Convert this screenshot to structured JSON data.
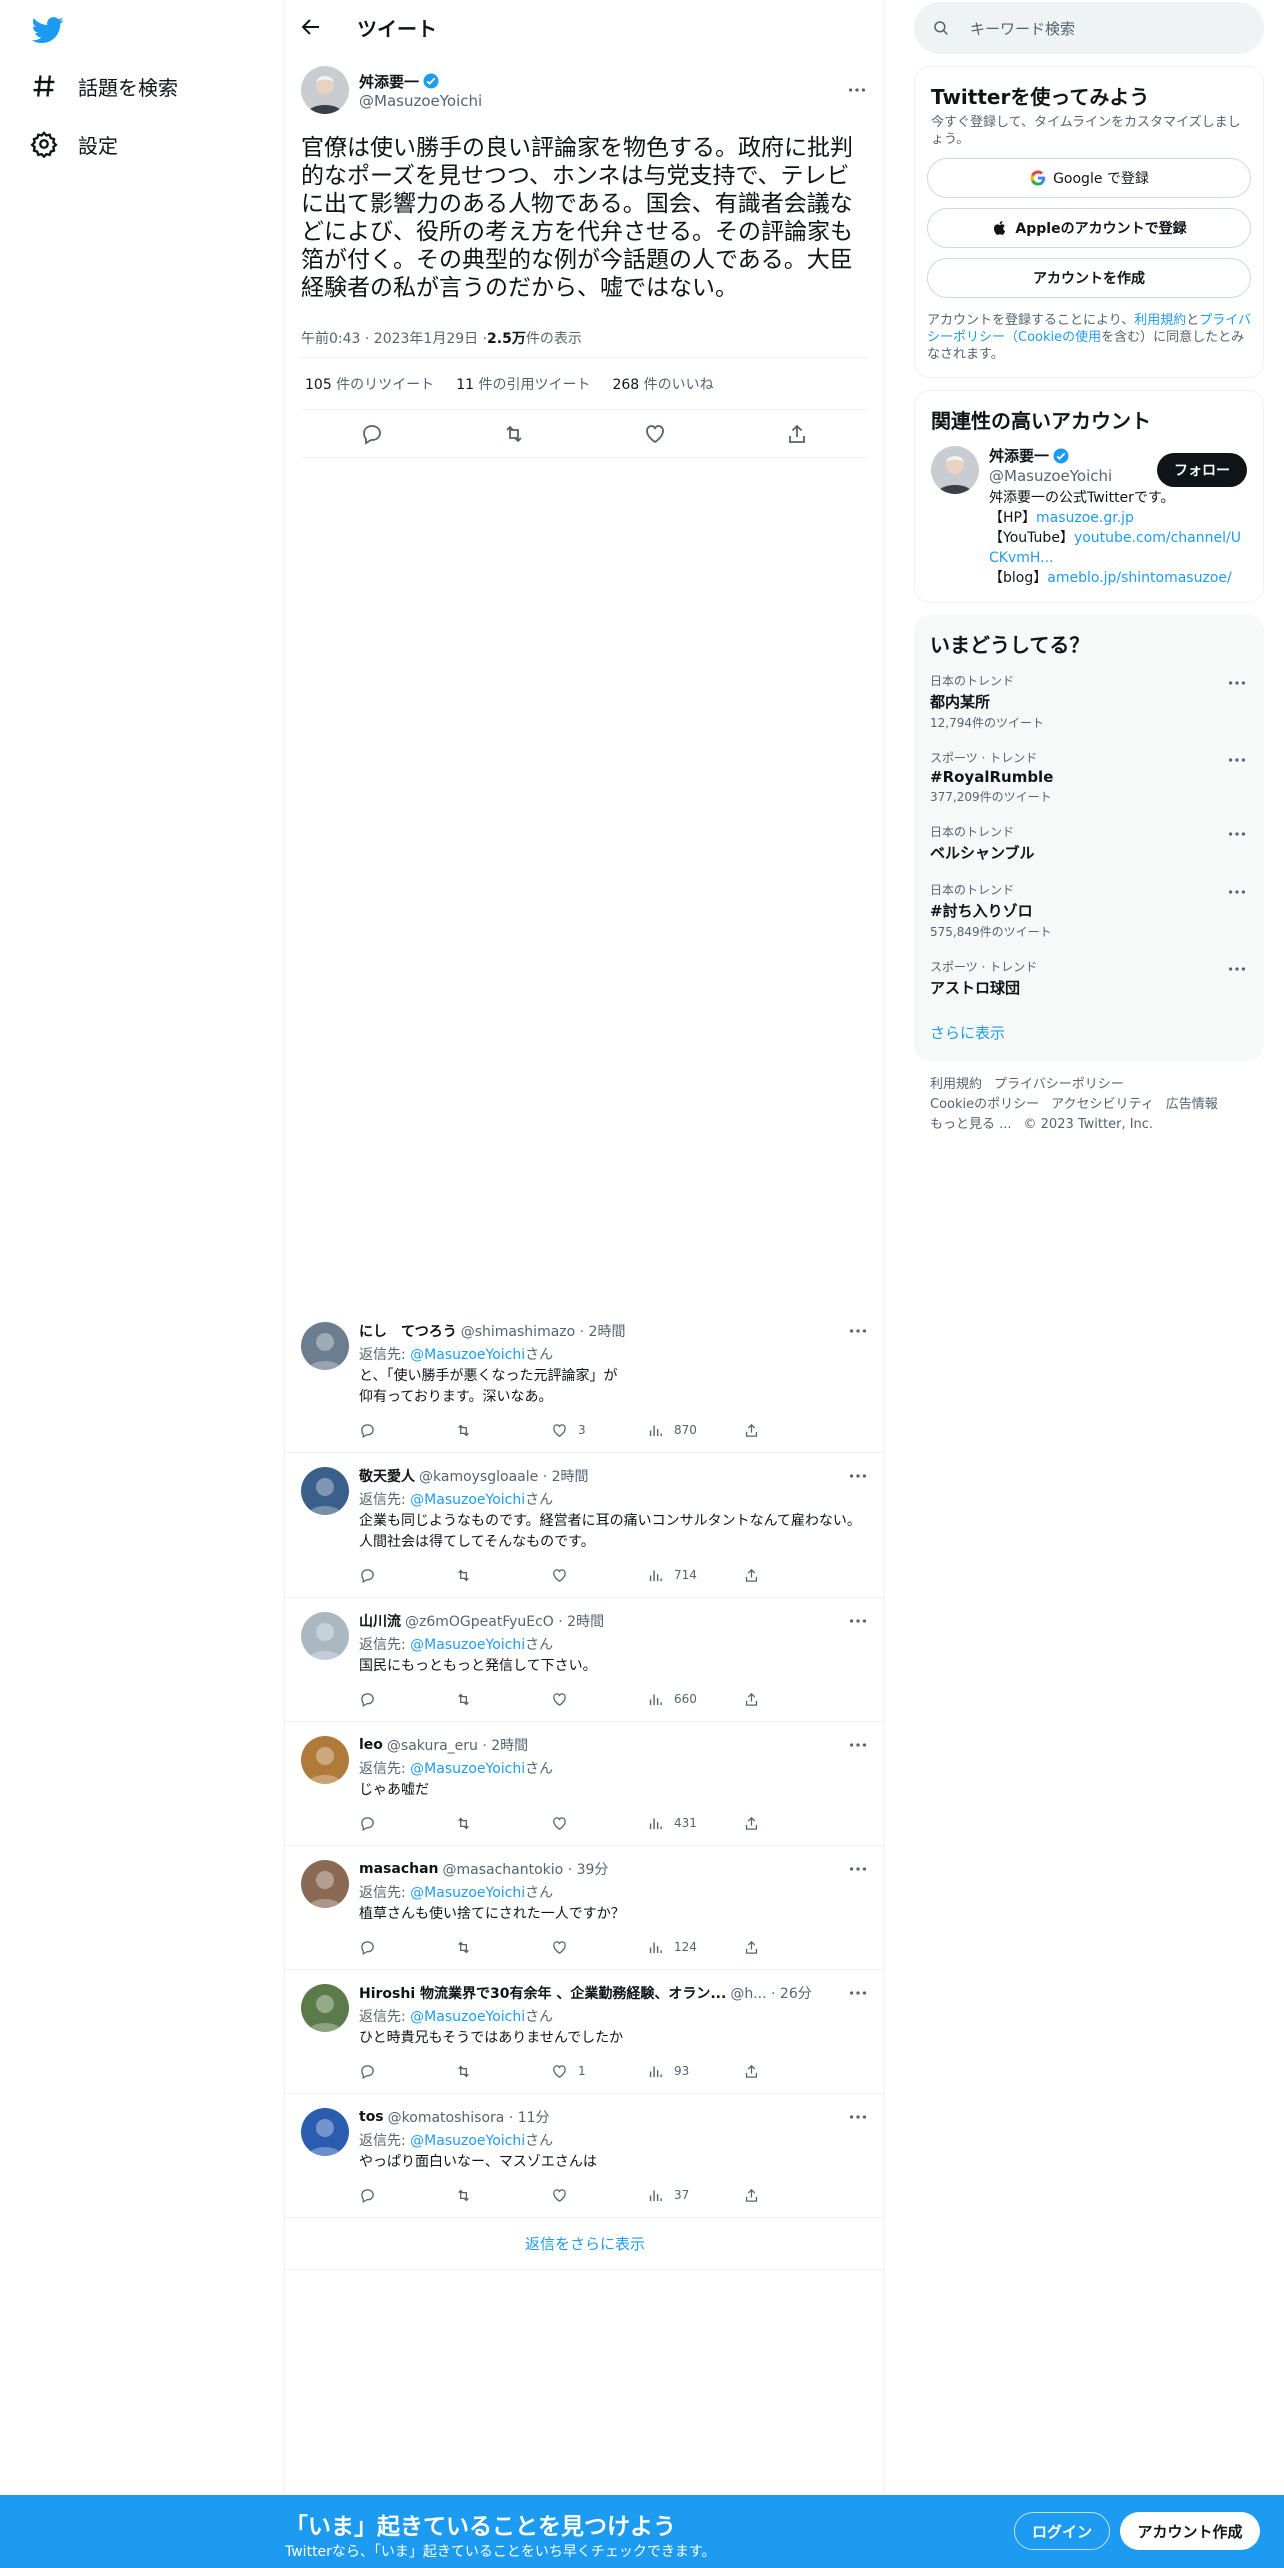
{
  "nav": {
    "explore_label": "話題を検索",
    "settings_label": "設定"
  },
  "header": {
    "title": "ツイート"
  },
  "tweet": {
    "author_name": "舛添要一",
    "author_handle": "@MasuzoeYoichi",
    "text": "官僚は使い勝手の良い評論家を物色する。政府に批判的なポーズを見せつつ、ホンネは与党支持で、テレビに出て影響力のある人物である。国会、有識者会議などによび、役所の考え方を代弁させる。その評論家も箔が付く。その典型的な例が今話題の人である。大臣経験者の私が言うのだから、嘘ではない。",
    "time": "午前0:43 · 2023年1月29日 · ",
    "views_count": "2.5万",
    "views_label": " 件の表示",
    "retweets_count": "105",
    "retweets_label": " 件のリツイート",
    "quotes_count": "11",
    "quotes_label": " 件の引用ツイート",
    "likes_count": "268",
    "likes_label": " 件のいいね"
  },
  "reply_to_prefix": "返信先: ",
  "reply_to_suffix": "さん",
  "replies": [
    {
      "name": "にし　てつろう",
      "handle": "@shimashimazo",
      "time": "· 2時間",
      "reply_to": "@MasuzoeYoichi",
      "text": "と、「使い勝手が悪くなった元評論家」が\n仰有っております。深いなあ。",
      "likes": "3",
      "views": "870"
    },
    {
      "name": "敬天愛人",
      "handle": "@kamoysgloaale",
      "time": "· 2時間",
      "reply_to": "@MasuzoeYoichi",
      "text": "企業も同じようなものです。経営者に耳の痛いコンサルタントなんて雇わない。人間社会は得てしてそんなものです。",
      "likes": "",
      "views": "714"
    },
    {
      "name": "山川流",
      "handle": "@z6mOGpeatFyuEcO",
      "time": "· 2時間",
      "reply_to": "@MasuzoeYoichi",
      "text": "国民にもっともっと発信して下さい。",
      "likes": "",
      "views": "660"
    },
    {
      "name": "leo",
      "handle": "@sakura_eru",
      "time": "· 2時間",
      "reply_to": "@MasuzoeYoichi",
      "text": "じゃあ嘘だ",
      "likes": "",
      "views": "431"
    },
    {
      "name": "masachan",
      "handle": "@masachantokio",
      "time": "· 39分",
      "reply_to": "@MasuzoeYoichi",
      "text": "植草さんも使い捨てにされた一人ですか？",
      "likes": "",
      "views": "124"
    },
    {
      "name": "Hiroshi 物流業界で30有余年 、企業勤務経験、オラン...",
      "handle": "@h...",
      "time": "· 26分",
      "reply_to": "@MasuzoeYoichi",
      "text": "ひと時貴兄もそうではありませんでしたか",
      "likes": "1",
      "views": "93"
    },
    {
      "name": "tos",
      "handle": "@komatoshisora",
      "time": "· 11分",
      "reply_to": "@MasuzoeYoichi",
      "text": "やっぱり面白いなー、マスゾエさんは",
      "likes": "",
      "views": "37"
    }
  ],
  "show_more_replies": "返信をさらに表示",
  "search": {
    "placeholder": "キーワード検索"
  },
  "signup": {
    "title": "Twitterを使ってみよう",
    "subtitle": "今すぐ登録して、タイムラインをカスタマイズしましょう。",
    "google": "Google で登録",
    "apple": "Appleのアカウントで登録",
    "create": "アカウントを作成",
    "terms_1": "アカウントを登録することにより、",
    "terms_link1": "利用規約",
    "terms_2": "と",
    "terms_link2": "プライバシーポリシー（Cookieの使用",
    "terms_3": "を含む）に同意したとみなされます。"
  },
  "related": {
    "title": "関連性の高いアカウント",
    "name": "舛添要一",
    "handle": "@MasuzoeYoichi",
    "follow": "フォロー",
    "bio_1": "舛添要一の公式Twitterです。",
    "bio_hp_label": "【HP】",
    "bio_hp": "masuzoe.gr.jp",
    "bio_yt_label": "【YouTube】",
    "bio_yt": "youtube.com/channel/UCKvmH...",
    "bio_blog_label": "【blog】",
    "bio_blog": "ameblo.jp/shintomasuzoe/"
  },
  "trends": {
    "title": "いまどうしてる？",
    "items": [
      {
        "context": "日本のトレンド",
        "name": "都内某所",
        "count": "12,794件のツイート"
      },
      {
        "context": "スポーツ · トレンド",
        "name": "#RoyalRumble",
        "count": "377,209件のツイート"
      },
      {
        "context": "日本のトレンド",
        "name": "ベルシャンブル",
        "count": ""
      },
      {
        "context": "日本のトレンド",
        "name": "#討ち入りゾロ",
        "count": "575,849件のツイート"
      },
      {
        "context": "スポーツ · トレンド",
        "name": "アストロ球団",
        "count": ""
      }
    ],
    "show_more": "さらに表示"
  },
  "footer": {
    "terms": "利用規約",
    "privacy": "プライバシーポリシー",
    "cookie": "Cookieのポリシー",
    "accessibility": "アクセシビリティ",
    "ads": "広告情報",
    "more": "もっと見る ...",
    "copyright": "© 2023 Twitter, Inc."
  },
  "bottombar": {
    "title": "「いま」起きていることを見つけよう",
    "subtitle": "Twitterなら、「いま」起きていることをいち早くチェックできます。",
    "login": "ログイン",
    "create": "アカウント作成"
  },
  "colors": {
    "accent": "#1d9bf0",
    "text": "#0f1419",
    "muted": "#536471"
  },
  "icons": [
    "twitter-logo-icon",
    "hash-icon",
    "gear-icon",
    "back-arrow-icon",
    "verified-icon",
    "more-icon",
    "reply-icon",
    "retweet-icon",
    "like-icon",
    "views-icon",
    "share-icon",
    "search-icon",
    "google-icon",
    "apple-icon"
  ]
}
